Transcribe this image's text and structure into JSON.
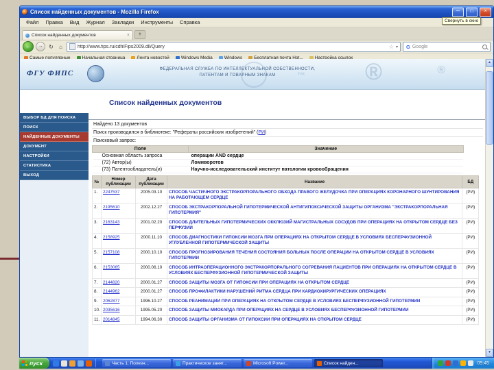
{
  "icons": {
    "minimize": "─",
    "restore": "□",
    "close": "×",
    "back": "←",
    "forward": "→",
    "reload": "↻",
    "stop": "×",
    "home": "⌂",
    "star": "☆",
    "caret": "▾",
    "new_tab": "+",
    "tab_close": "×",
    "google_g": "G",
    "scroll_up": "▲",
    "scroll_down": "▼",
    "reg_mark": "®",
    "tm_mark": "™"
  },
  "window": {
    "title": "Список найденных документов - Mozilla Firefox",
    "tooltip": "Свернуть в окно",
    "menu": [
      {
        "label": "Файл"
      },
      {
        "label": "Правка"
      },
      {
        "label": "Вид"
      },
      {
        "label": "Журнал"
      },
      {
        "label": "Закладки"
      },
      {
        "label": "Инструменты"
      },
      {
        "label": "Справка"
      }
    ],
    "tab_label": "Список найденных документов",
    "address": "http://www.fips.ru/cdfi/Fips2009.dll/Query",
    "search_engine": "Google",
    "bookmarks": [
      {
        "name": "popular-bookmark",
        "label": "Самые популярные",
        "color": "#e07a2a"
      },
      {
        "name": "home-bookmark",
        "label": "Начальная страница",
        "color": "#3f8f3a"
      },
      {
        "name": "feed-bookmark",
        "label": "Лента новостей",
        "color": "#e8a020"
      },
      {
        "name": "windows-media-bookmark",
        "label": "Windows Media",
        "color": "#2f6fd0"
      },
      {
        "name": "windows-bookmark",
        "label": "Windows",
        "color": "#58a0e8"
      },
      {
        "name": "hotmail-bookmark",
        "label": "Бесплатная почта Hot...",
        "color": "#d0a040"
      },
      {
        "name": "links-folder-bookmark",
        "label": "Настройка ссылок",
        "color": "#d8c060"
      }
    ]
  },
  "site": {
    "logo": "ФГУ ФИПС",
    "agency1": "ФЕДЕРАЛЬНАЯ СЛУЖБА ПО ИНТЕЛЛЕКТУАЛЬНОЙ СОБСТВЕННОСТИ,",
    "agency2": "ПАТЕНТАМ И ТОВАРНЫМ ЗНАКАМ",
    "heading": "Список найденных документов",
    "sidebar": [
      {
        "label": "ВЫБОР БД ДЛЯ ПОИСКА"
      },
      {
        "label": "ПОИСК"
      },
      {
        "label": "НАЙДЕННЫЕ ДОКУМЕНТЫ",
        "active": true
      },
      {
        "label": "ДОКУМЕНТ"
      },
      {
        "label": "НАСТРОЙКИ"
      },
      {
        "label": "СТАТИСТИКА"
      },
      {
        "label": "ВЫХОД"
      }
    ],
    "found_line": "Найдено 13 документов",
    "library_prefix": "Поиск производился в библиотеке: \"Рефераты российских изобретений\" (",
    "library_link": "РИ",
    "library_suffix": ")",
    "query_label": "Поисковый запрос:",
    "query_table": {
      "col_field": "Поле",
      "col_value": "Значение",
      "rows": [
        {
          "field": "Основная область запроса",
          "value": "операции AND сердце"
        },
        {
          "field": "(72) Автор(ы)",
          "value": "Ломиворотов"
        },
        {
          "field": "(73) Патентообладатель(и)",
          "value": "Научно-исследовательский институт патологии кровообращения"
        }
      ]
    },
    "results": {
      "col_num": "№",
      "col_number": "Номер публикации",
      "col_date": "Дата публикации",
      "col_title": "Название",
      "col_db": "БД",
      "rows": [
        {
          "num": "1.",
          "number": "2247537",
          "date": "2005.03.10",
          "title": "СПОСОБ ЧАСТИЧНОГО ЭКСТРАКОРПОРАЛЬНОГО ОБХОДА ПРАВОГО ЖЕЛУДОЧКА ПРИ ОПЕРАЦИЯХ КОРОНАРНОГО ШУНТИРОВАНИЯ НА РАБОТАЮЩЕМ СЕРДЦЕ",
          "db": "(РИ)"
        },
        {
          "num": "2.",
          "number": "2195610",
          "date": "2002.12.27",
          "title": "СПОСОБ ЭКСТРАКОРПОРАЛЬНОЙ ГИПОТЕРМИЧЕСКОЙ АНТИГИПОКСИЧЕСКОЙ ЗАЩИТЫ ОРГАНИЗМА \"ЭКСТРАКОРПОРАЛЬНАЯ ГИПОТЕРМИЯ\"",
          "db": "(РИ)"
        },
        {
          "num": "3.",
          "number": "2163143",
          "date": "2001.02.20",
          "title": "СПОСОБ ДЛИТЕЛЬНЫХ ГИПОТЕРМИЧЕСКИХ ОККЛЮЗИЙ МАГИСТРАЛЬНЫХ СОСУДОВ ПРИ ОПЕРАЦИЯХ НА ОТКРЫТОМ СЕРДЦЕ БЕЗ ПЕРФУЗИИ",
          "db": "(РИ)"
        },
        {
          "num": "4.",
          "number": "2158925",
          "date": "2000.11.10",
          "title": "СПОСОБ ДИАГНОСТИКИ ГИПОКСИИ МОЗГА ПРИ ОПЕРАЦИЯХ НА ОТКРЫТОМ СЕРДЦЕ В УСЛОВИЯХ БЕСПЕРФУЗИОННОЙ УГЛУБЛЕННОЙ ГИПОТЕРМИЧЕСКОЙ ЗАЩИТЫ",
          "db": "(РИ)"
        },
        {
          "num": "5.",
          "number": "2157108",
          "date": "2000.10.10",
          "title": "СПОСОБ ПРОГНОЗИРОВАНИЯ ТЕЧЕНИЯ СОСТОЯНИЯ БОЛЬНЫХ ПОСЛЕ ОПЕРАЦИИ НА ОТКРЫТОМ СЕРДЦЕ В УСЛОВИЯХ ГИПОТЕРМИИ",
          "db": "(РИ)"
        },
        {
          "num": "6.",
          "number": "2153065",
          "date": "2000.06.10",
          "title": "СПОСОБ ИНТРАОПЕРАЦИОННОГО ЭКСТРАКОРПОРАЛЬНОГО СОГРЕВАНИЯ ПАЦИЕНТОВ ПРИ ОПЕРАЦИЯХ НА ОТКРЫТОМ СЕРДЦЕ В УСЛОВИЯХ БЕСПЕРФУЗИОННОЙ ГИПОТЕРМИЧЕСКОЙ ЗАЩИТЫ",
          "db": "(РИ)"
        },
        {
          "num": "7.",
          "number": "2144820",
          "date": "2000.01.27",
          "title": "СПОСОБ ЗАЩИТЫ МОЗГА ОТ ГИПОКСИИ ПРИ ОПЕРАЦИЯХ НА ОТКРЫТОМ СЕРДЦЕ",
          "db": "(РИ)"
        },
        {
          "num": "8.",
          "number": "2144962",
          "date": "2000.01.27",
          "title": "СПОСОБ ПРОФИЛАКТИКИ НАРУШЕНИЙ РИТМА СЕРДЦА ПРИ КАРДИОХИРУРГИЧЕСКИХ ОПЕРАЦИЯХ",
          "db": "(РИ)"
        },
        {
          "num": "9.",
          "number": "2062877",
          "date": "1996.10.27",
          "title": "СПОСОБ РЕАНИМАЦИИ ПРИ ОПЕРАЦИЯХ НА ОТКРЫТОМ СЕРДЦЕ В УСЛОВИЯХ БЕСПЕРФУЗИОННОЙ ГИПОТЕРМИИ",
          "db": "(РИ)"
        },
        {
          "num": "10.",
          "number": "2035616",
          "date": "1995.05.20",
          "title": "СПОСОБ ЗАЩИТЫ МИОКАРДА ПРИ ОПЕРАЦИЯХ НА СЕРДЦЕ В УСЛОВИЯХ БЕСПЕРФУЗИОННОЙ ГИПОТЕРМИИ",
          "db": "(РИ)"
        },
        {
          "num": "11.",
          "number": "2014845",
          "date": "1994.06.30",
          "title": "СПОСОБ ЗАЩИТЫ ОРГАНИЗМА ОТ ГИПОКСИИ ПРИ ОПЕРАЦИЯХ НА ОТКРЫТОМ СЕРДЦЕ",
          "db": "(РИ)"
        }
      ]
    }
  },
  "taskbar": {
    "start_label": "пуск",
    "quick_launch": [
      {
        "name": "internet-explorer-icon",
        "color": "#2f7ae5"
      },
      {
        "name": "show-desktop-icon",
        "color": "#e8e4d8"
      },
      {
        "name": "windows-media-icon",
        "color": "#f0a030"
      },
      {
        "name": "outlook-icon",
        "color": "#7ab0e8"
      },
      {
        "name": "firefox-icon",
        "color": "#e66000"
      }
    ],
    "buttons": [
      {
        "name": "task-document",
        "label": "Часть 1. Полезн...",
        "color": "#5b84d6"
      },
      {
        "name": "task-lesson",
        "label": "Практическое занят...",
        "color": "#3ba0e8"
      },
      {
        "name": "task-powerpoint",
        "label": "Microsoft Power...",
        "color": "#d04727"
      },
      {
        "name": "task-firefox",
        "label": "Список найден...",
        "color": "#e66000",
        "active": true
      }
    ],
    "tray_icons": [
      {
        "name": "messenger-icon",
        "color": "#35a435"
      },
      {
        "name": "antivirus-icon",
        "color": "#d03a2a"
      },
      {
        "name": "network-icon",
        "color": "#2f6fd0"
      },
      {
        "name": "update-icon",
        "color": "#ffb300"
      },
      {
        "name": "volume-icon",
        "color": "#e8e8e8"
      }
    ],
    "clock": "09:45"
  }
}
